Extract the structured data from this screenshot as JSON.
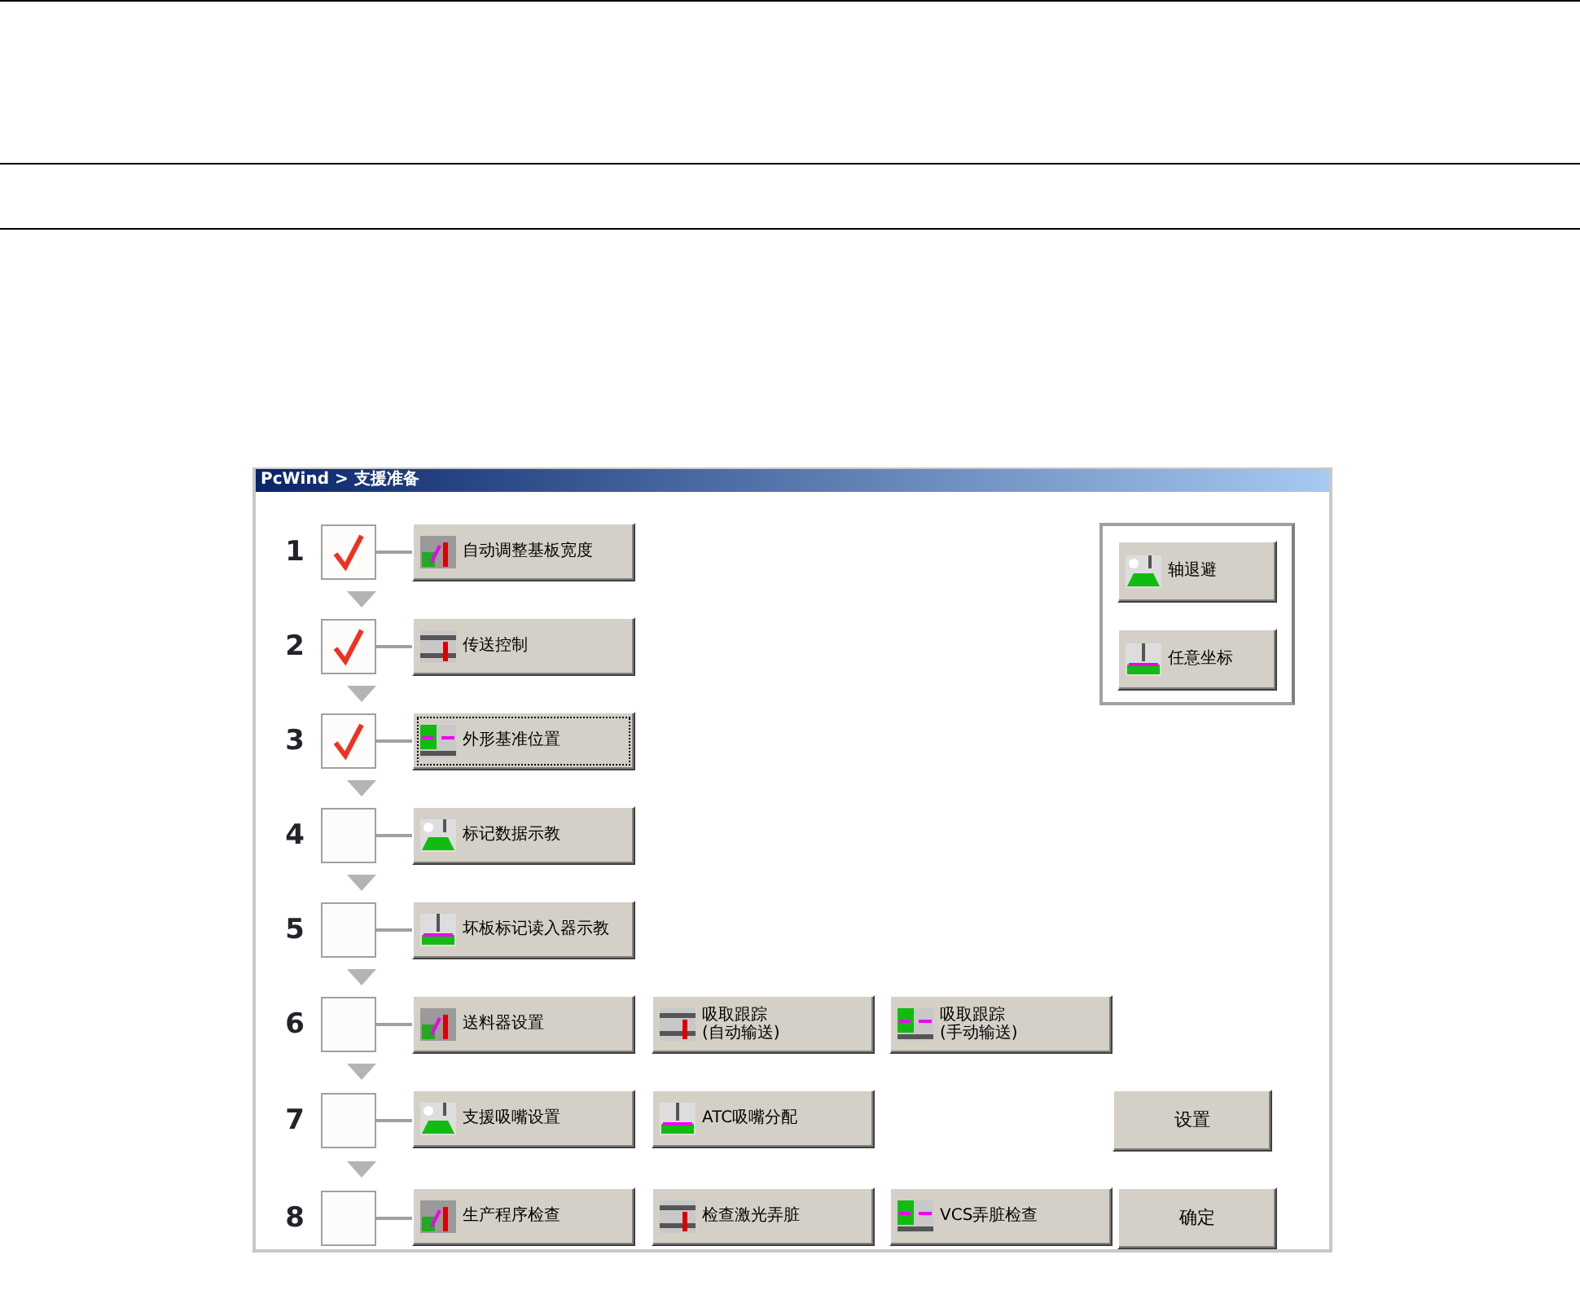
{
  "window": {
    "title": "PcWind > 支援准备"
  },
  "steps": [
    {
      "number": "1",
      "checked": true,
      "buttons": [
        {
          "label": "自动调整基板宽度",
          "focused": false
        }
      ]
    },
    {
      "number": "2",
      "checked": true,
      "buttons": [
        {
          "label": "传送控制",
          "focused": false
        }
      ]
    },
    {
      "number": "3",
      "checked": true,
      "buttons": [
        {
          "label": "外形基准位置",
          "focused": true
        }
      ]
    },
    {
      "number": "4",
      "checked": false,
      "buttons": [
        {
          "label": "标记数据示教",
          "focused": false
        }
      ]
    },
    {
      "number": "5",
      "checked": false,
      "buttons": [
        {
          "label": "坏板标记读入器示教",
          "focused": false
        }
      ]
    },
    {
      "number": "6",
      "checked": false,
      "buttons": [
        {
          "label": "送料器设置",
          "focused": false
        },
        {
          "label": "吸取跟踪",
          "sublabel": "(自动输送)",
          "focused": false
        },
        {
          "label": "吸取跟踪",
          "sublabel": "(手动输送)",
          "focused": false
        }
      ]
    },
    {
      "number": "7",
      "checked": false,
      "buttons": [
        {
          "label": "支援吸嘴设置",
          "focused": false
        },
        {
          "label": "ATC吸嘴分配",
          "focused": false
        }
      ]
    },
    {
      "number": "8",
      "checked": false,
      "buttons": [
        {
          "label": "生产程序检查",
          "focused": false
        },
        {
          "label": "检查激光弄脏",
          "focused": false
        },
        {
          "label": "VCS弄脏检查",
          "focused": false
        }
      ]
    }
  ],
  "side_panel": {
    "buttons": [
      {
        "label": "轴退避"
      },
      {
        "label": "任意坐标"
      }
    ]
  },
  "setup_button": {
    "label": "设置"
  },
  "ok_button": {
    "label": "确定"
  }
}
